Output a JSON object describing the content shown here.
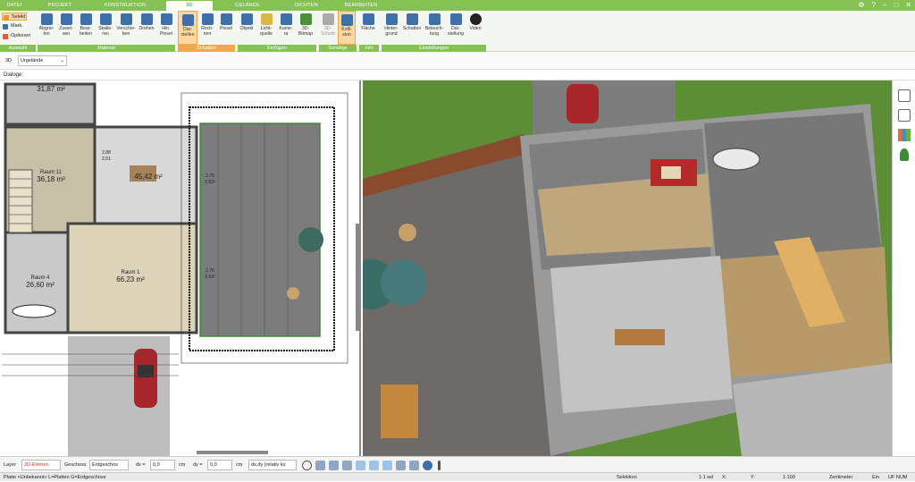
{
  "tabs": [
    "DATEI",
    "PROJEKT",
    "KONSTRUKTION",
    "3D",
    "GELÄNDE",
    "DICHTEN",
    "BEARBEITEN"
  ],
  "active_tab": "3D",
  "left_tools": [
    "Selekt",
    "Mark.",
    "Optionen"
  ],
  "left_group": "Auswahl",
  "ribbon_buttons": [
    {
      "label": "Abgrei-\nfen"
    },
    {
      "label": "Zuwei-\nsen"
    },
    {
      "label": "Bear-\nbeiten"
    },
    {
      "label": "Skalie-\nren"
    },
    {
      "label": "Verschie-\nben"
    },
    {
      "label": "Drehen"
    },
    {
      "label": "Hin.\nPinsel"
    },
    {
      "label": "Dar-\nstellen"
    },
    {
      "label": "Rech-\nnen"
    },
    {
      "label": "Pinsel"
    },
    {
      "label": "Objekt"
    },
    {
      "label": "Licht-\nquelle"
    },
    {
      "label": "Kame-\nra"
    },
    {
      "label": "3D-\nBitmap"
    },
    {
      "label": "3D-\nSchnitt"
    },
    {
      "label": "Kolli-\nsion"
    },
    {
      "label": "Fläche"
    },
    {
      "label": "Hinter-\ngrund"
    },
    {
      "label": "Schatten"
    },
    {
      "label": "Beleuch-\ntung"
    },
    {
      "label": "Dar-\nstellung"
    },
    {
      "label": "Video"
    }
  ],
  "groups": [
    "Material",
    "Schatten",
    "Einfügen",
    "Sonstige",
    "Info",
    "Einstellungen"
  ],
  "view_selector": {
    "mode": "3D",
    "value": "Urgelände"
  },
  "dialog_label": "Dialoge:",
  "rooms": [
    {
      "name": "",
      "area": "31,87 m²"
    },
    {
      "name": "Raum 11",
      "area": "36,18 m²"
    },
    {
      "name": "",
      "area": "45,42 m²"
    },
    {
      "name": "Raum 1",
      "area": "66,23 m²"
    },
    {
      "name": "Raum 4",
      "area": "26,60 m²"
    }
  ],
  "dims": [
    "2,76\n2,63²",
    "2,76\n2,63²",
    "2,88\n2,01"
  ],
  "status": {
    "layer_label": "Layer",
    "layer_value": "2D-Elemen",
    "geschoss_label": "Geschoss",
    "geschoss_value": "Erdgeschos",
    "dx_label": "dx =",
    "dx_value": "0,0",
    "dx_unit": "cm",
    "dy_label": "dy =",
    "dy_value": "0,0",
    "dy_unit": "cm",
    "mode_value": "dx,dy (relativ ko"
  },
  "info": {
    "left": "Platte <Unbekannt> L=Platten G=Erdgeschoss",
    "mode": "Selektion",
    "sel": "1:1 sel",
    "x": "X:",
    "y": "Y:",
    "scale": "1:100",
    "unit": "Zentimeter",
    "ein": "Ein",
    "uf": "UF NUM"
  },
  "colors": {
    "ribbon_green": "#86c153",
    "highlight": "#f0a94a",
    "grass": "#5b8c34"
  }
}
